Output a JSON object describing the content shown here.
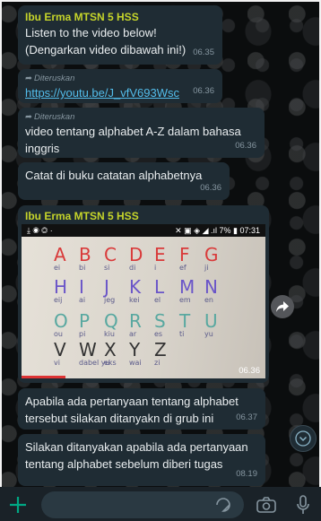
{
  "messages": [
    {
      "sender": "Ibu Erma MTSN 5 HSS",
      "text": "Listen to the video below!\n(Dengarkan video dibawah ini!)",
      "time": "06.35"
    },
    {
      "forwarded_label": "Diteruskan",
      "link": "https://youtu.be/J_vfV693Wsc",
      "time": "06.36"
    },
    {
      "forwarded_label": "Diteruskan",
      "text": "video tentang alphabet A-Z dalam bahasa\ninggris",
      "time": "06.36"
    },
    {
      "text": "Catat di buku catatan alphabetnya",
      "time": "06.36"
    },
    {
      "sender": "Ibu Erma MTSN 5 HSS",
      "media_time": "06.36"
    },
    {
      "text": "Apabila ada pertanyaan tentang alphabet\ntersebut silakan ditanyakn di grub ini",
      "time": "06.37"
    },
    {
      "text": "Silakan ditanyakan apabila ada pertanyaan\ntentang alphabet sebelum diberi tugas",
      "time": "08.19"
    }
  ],
  "video": {
    "status_left": "⤓ ◉ ◎ ·",
    "status_right": "✕ ▣ ◈ ◢ .ıl 7% ▮ 07:31",
    "rows": [
      {
        "letters": [
          "A",
          "B",
          "C",
          "D",
          "E",
          "F",
          "G"
        ],
        "subs": [
          "ei",
          "bi",
          "si",
          "di",
          "i",
          "ef",
          "ji"
        ],
        "color": "#d93a3a"
      },
      {
        "letters": [
          "H",
          "I",
          "J",
          "K",
          "L",
          "M",
          "N"
        ],
        "subs": [
          "eij",
          "ai",
          "jeg",
          "kei",
          "el",
          "em",
          "en"
        ],
        "color": "#6a55c8"
      },
      {
        "letters": [
          "O",
          "P",
          "Q",
          "R",
          "S",
          "T",
          "U"
        ],
        "subs": [
          "ou",
          "pi",
          "kiu",
          "ar",
          "es",
          "ti",
          "yu"
        ],
        "color": "#58a8a0"
      },
      {
        "letters": [
          "V",
          "W",
          "X",
          "Y",
          "Z"
        ],
        "subs": [
          "vi",
          "dabel yu",
          "eks",
          "wai",
          "zi"
        ],
        "color": "#333333"
      }
    ],
    "progress": 0.18
  },
  "icons": {
    "forward": "forward-arrow-icon",
    "share": "share-icon",
    "scroll": "chevron-down-icon",
    "attach": "plus-icon",
    "sticker": "sticker-icon",
    "camera": "camera-icon",
    "mic": "mic-icon"
  },
  "colors": {
    "bubble": "#1f2c34",
    "sender": "#c6d52a",
    "link": "#53bdeb",
    "meta": "#8696a0",
    "accent": "#00a884"
  }
}
